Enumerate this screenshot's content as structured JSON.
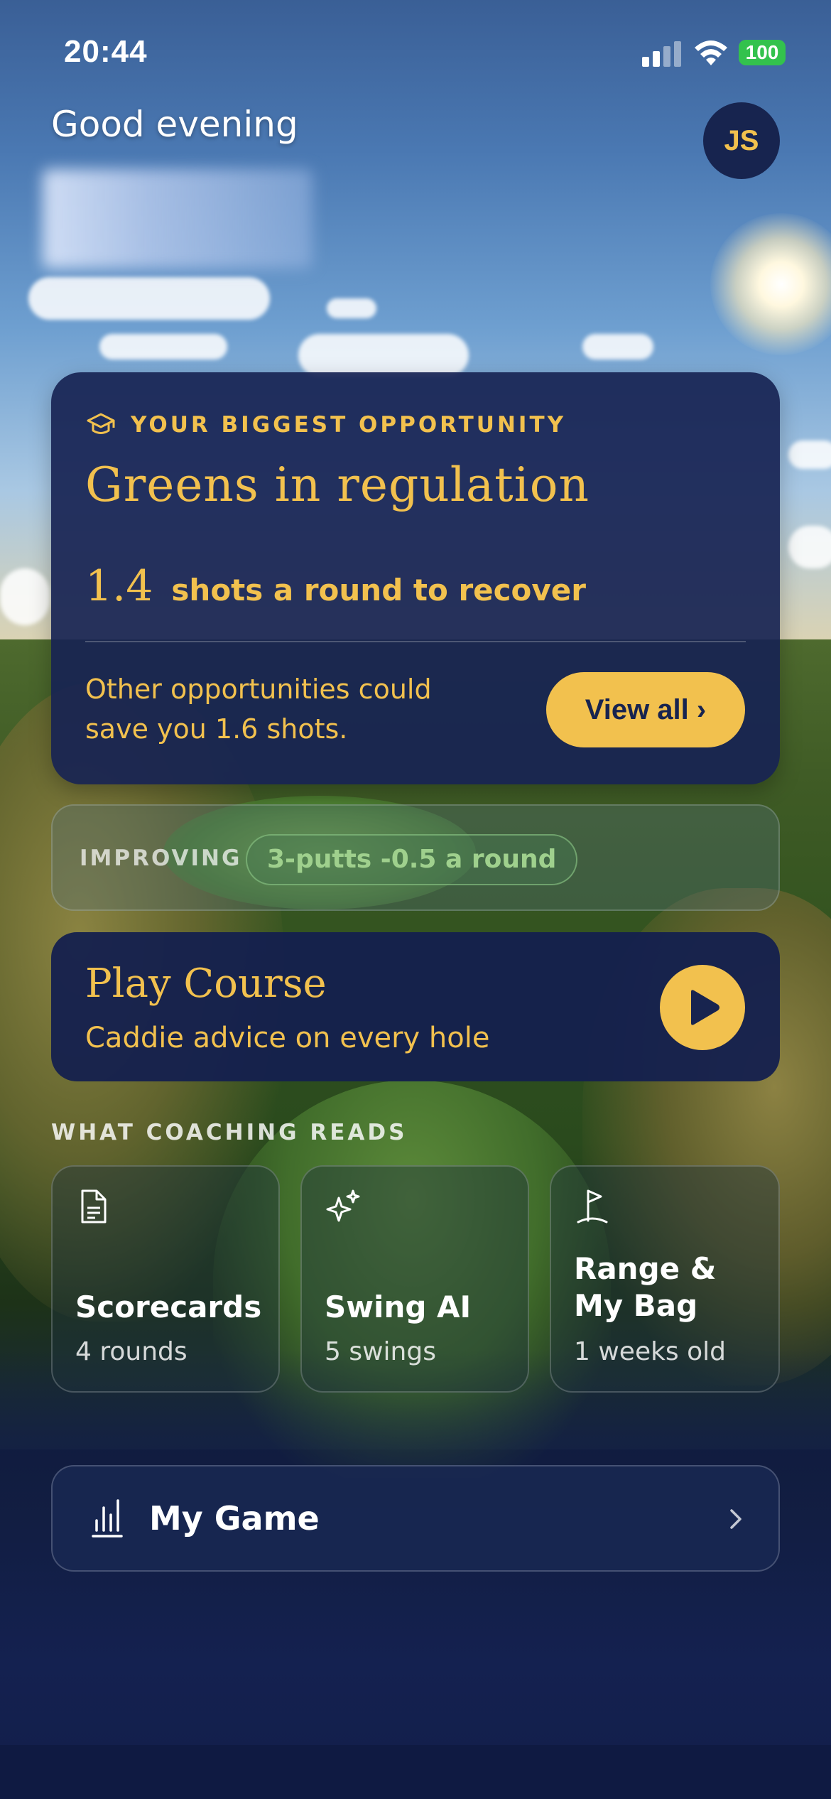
{
  "status_bar": {
    "time": "20:44",
    "battery": "100",
    "battery_color": "#33c24d",
    "icons": [
      "signal-icon",
      "wifi-icon",
      "battery-icon"
    ]
  },
  "header": {
    "greeting": "Good evening",
    "avatar_initials": "JS"
  },
  "opportunity": {
    "heading": "YOUR BIGGEST OPPORTUNITY",
    "icon": "graduation-cap-icon",
    "title": "Greens in regulation",
    "shots_value": "1.4",
    "shots_text": "shots a round to recover",
    "other_text": "Other opportunities could save you 1.6 shots.",
    "view_all_label": "View all ›"
  },
  "improving": {
    "label": "IMPROVING",
    "pill": "3-putts -0.5 a round"
  },
  "play_course": {
    "title": "Play Course",
    "subtitle": "Caddie advice on every hole",
    "icon": "play-icon"
  },
  "coaching": {
    "section_label": "WHAT COACHING READS",
    "tiles": [
      {
        "title": "Scorecards",
        "subtitle": "4 rounds",
        "icon": "document-icon"
      },
      {
        "title": "Swing AI",
        "subtitle": "5 swings",
        "icon": "sparkles-icon"
      },
      {
        "title": "Range & My Bag",
        "subtitle": "1 weeks old",
        "icon": "flag-icon"
      }
    ]
  },
  "my_game": {
    "label": "My Game",
    "icon": "bar-chart-icon"
  },
  "colors": {
    "accent": "#f2c14e",
    "card_navy": "#17234f",
    "improving_green": "#9fd08d"
  }
}
